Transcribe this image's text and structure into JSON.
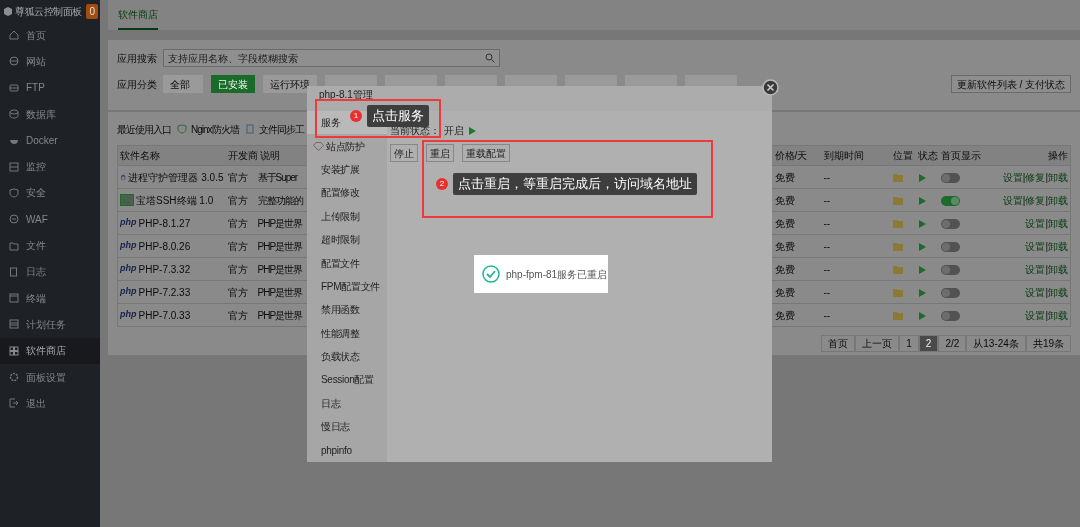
{
  "brand": {
    "title": "尊狐云控制面板",
    "badge": "0"
  },
  "nav": [
    {
      "label": "首页",
      "selected": false
    },
    {
      "label": "网站",
      "selected": false
    },
    {
      "label": "FTP",
      "selected": false
    },
    {
      "label": "数据库",
      "selected": false
    },
    {
      "label": "Docker",
      "selected": false
    },
    {
      "label": "监控",
      "selected": false
    },
    {
      "label": "安全",
      "selected": false
    },
    {
      "label": "WAF",
      "selected": false
    },
    {
      "label": "文件",
      "selected": false
    },
    {
      "label": "日志",
      "selected": false
    },
    {
      "label": "终端",
      "selected": false
    },
    {
      "label": "计划任务",
      "selected": false
    },
    {
      "label": "软件商店",
      "selected": true
    },
    {
      "label": "面板设置",
      "selected": false
    },
    {
      "label": "退出",
      "selected": false
    }
  ],
  "tabs": [
    {
      "label": "软件商店",
      "selected": true
    }
  ],
  "search": {
    "label": "应用搜索",
    "placeholder": "支持应用名称、字段模糊搜索"
  },
  "categories": {
    "label": "应用分类",
    "items": [
      {
        "label": "全部",
        "selected": false
      },
      {
        "label": "已安装",
        "selected": true
      },
      {
        "label": "运行环境",
        "selected": false
      },
      {
        "covered": true,
        "selected": false
      },
      {
        "covered": true,
        "selected": false
      },
      {
        "covered": true,
        "selected": false
      },
      {
        "covered": true,
        "selected": false
      },
      {
        "covered": true,
        "selected": false
      },
      {
        "covered": true,
        "selected": false
      },
      {
        "covered": true,
        "selected": false
      }
    ]
  },
  "update_button": "更新软件列表 / 支付状态",
  "recent": {
    "label": "最近使用入口",
    "items": [
      "Nginx防火墙",
      "文件同步工"
    ]
  },
  "table": {
    "separator": "|",
    "columns": [
      "软件名称",
      "开发商",
      "说明",
      "价格/天",
      "到期时间",
      "位置",
      "状态",
      "首页显示",
      "操作"
    ],
    "rows": [
      {
        "kind": "linux",
        "name": "进程守护管理器 3.0.5",
        "developer": "官方",
        "description": "基于Super",
        "price": "免费",
        "expiry": "--",
        "running": true,
        "home_display": false,
        "actions": [
          "设置",
          "修复",
          "卸载"
        ]
      },
      {
        "kind": "terminal",
        "name": "宝塔SSH终端 1.0",
        "developer": "官方",
        "description": "完整功能的",
        "price": "免费",
        "expiry": "--",
        "running": true,
        "home_display": true,
        "actions": [
          "设置",
          "修复",
          "卸载"
        ]
      },
      {
        "kind": "php",
        "icon_text": "php",
        "name": "PHP-8.1.27",
        "developer": "官方",
        "description": "PHP是世界",
        "price": "免费",
        "expiry": "--",
        "running": true,
        "home_display": false,
        "actions": [
          "设置",
          "卸载"
        ]
      },
      {
        "kind": "php",
        "icon_text": "php",
        "name": "PHP-8.0.26",
        "developer": "官方",
        "description": "PHP是世界",
        "price": "免费",
        "expiry": "--",
        "running": true,
        "home_display": false,
        "actions": [
          "设置",
          "卸载"
        ]
      },
      {
        "kind": "php",
        "icon_text": "php",
        "name": "PHP-7.3.32",
        "developer": "官方",
        "description": "PHP是世界",
        "price": "免费",
        "expiry": "--",
        "running": true,
        "home_display": false,
        "actions": [
          "设置",
          "卸载"
        ]
      },
      {
        "kind": "php",
        "icon_text": "php",
        "name": "PHP-7.2.33",
        "developer": "官方",
        "description": "PHP是世界",
        "price": "免费",
        "expiry": "--",
        "running": true,
        "home_display": false,
        "actions": [
          "设置",
          "卸载"
        ]
      },
      {
        "kind": "php",
        "icon_text": "php",
        "name": "PHP-7.0.33",
        "developer": "官方",
        "description": "PHP是世界",
        "price": "免费",
        "expiry": "--",
        "running": true,
        "home_display": false,
        "actions": [
          "设置",
          "卸载"
        ]
      }
    ]
  },
  "pagination": [
    {
      "label": "首页",
      "selected": false
    },
    {
      "label": "上一页",
      "selected": false
    },
    {
      "label": "1",
      "selected": false
    },
    {
      "label": "2",
      "selected": true
    },
    {
      "label": "2/2",
      "selected": false
    },
    {
      "label": "从13-24条",
      "selected": false
    },
    {
      "label": "共19条",
      "selected": false
    }
  ],
  "modal": {
    "title": "php-8.1管理",
    "menu": [
      {
        "label": "服务",
        "selected": true,
        "has_icon": false
      },
      {
        "label": "站点防护",
        "selected": false,
        "has_icon": true
      },
      {
        "label": "安装扩展",
        "selected": false,
        "has_icon": false
      },
      {
        "label": "配置修改",
        "selected": false,
        "has_icon": false
      },
      {
        "label": "上传限制",
        "selected": false,
        "has_icon": false
      },
      {
        "label": "超时限制",
        "selected": false,
        "has_icon": false
      },
      {
        "label": "配置文件",
        "selected": false,
        "has_icon": false
      },
      {
        "label": "FPM配置文件",
        "selected": false,
        "has_icon": false
      },
      {
        "label": "禁用函数",
        "selected": false,
        "has_icon": false
      },
      {
        "label": "性能调整",
        "selected": false,
        "has_icon": false
      },
      {
        "label": "负载状态",
        "selected": false,
        "has_icon": false
      },
      {
        "label": "Session配置",
        "selected": false,
        "has_icon": false
      },
      {
        "label": "日志",
        "selected": false,
        "has_icon": false
      },
      {
        "label": "慢日志",
        "selected": false,
        "has_icon": false
      },
      {
        "label": "phpinfo",
        "selected": false,
        "has_icon": false
      }
    ],
    "status_label": "当前状态：",
    "status_value": "开启",
    "running": true,
    "buttons": [
      "停止",
      "重启",
      "重载配置"
    ],
    "toast": "php-fpm-81服务已重启"
  },
  "annotations": [
    {
      "number": "1",
      "text": "点击服务"
    },
    {
      "number": "2",
      "text": "点击重启，等重启完成后，访问域名地址"
    }
  ]
}
